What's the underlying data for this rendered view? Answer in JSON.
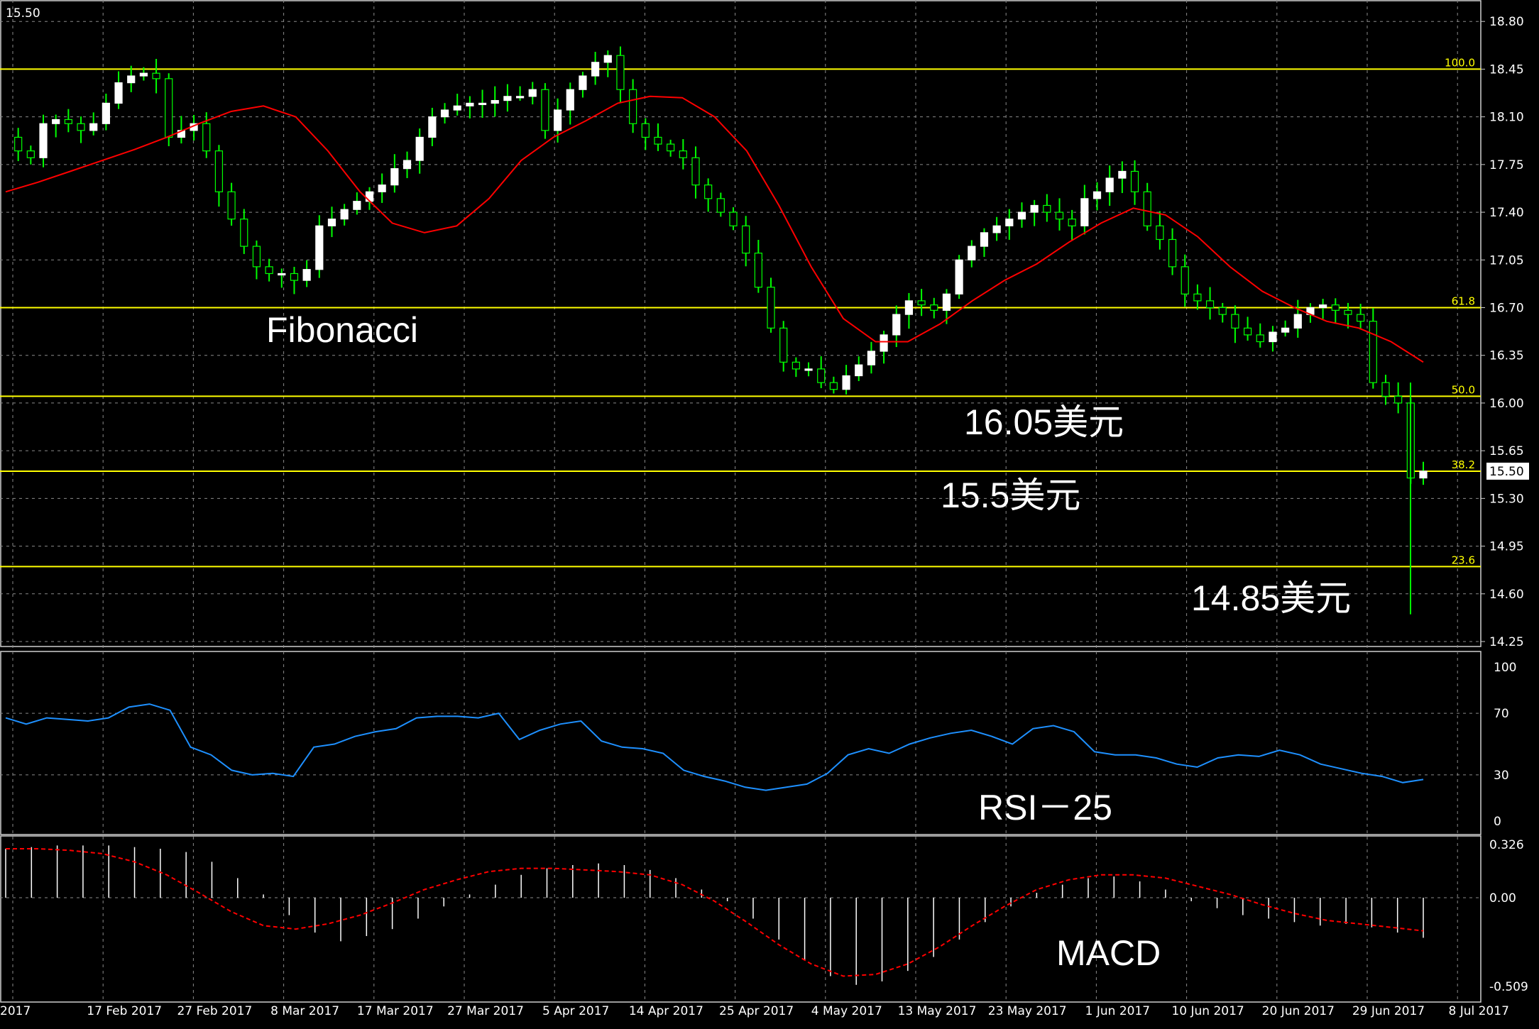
{
  "symbol_label": "15.50",
  "colors": {
    "background": "#000000",
    "grid": "#8a8a8a",
    "bull_candle": "#ffffff",
    "bear_candle": "#000000",
    "wick": "#00ff00",
    "ma_line": "#ff0000",
    "fib_line": "#ffff00",
    "rsi_line": "#1e90ff",
    "macd_histogram": "#ffffff",
    "macd_signal": "#ff0000",
    "text": "#ffffff"
  },
  "annotations": {
    "fibonacci": "Fibonacci",
    "level_1605": "16.05美元",
    "level_155": "15.5美元",
    "level_1485": "14.85美元",
    "rsi": "RSI－25",
    "macd": "MACD"
  },
  "chart_data": [
    {
      "type": "candlestick",
      "panel": "price",
      "ylim": [
        14.25,
        18.9
      ],
      "y_ticks": [
        "18.80",
        "18.45",
        "18.10",
        "17.75",
        "17.40",
        "17.05",
        "16.70",
        "16.35",
        "16.00",
        "15.65",
        "15.30",
        "14.95",
        "14.60",
        "14.25"
      ],
      "current_price": "15.50",
      "fib_levels": [
        {
          "label": "100.0",
          "value": 18.45
        },
        {
          "label": "61.8",
          "value": 16.7
        },
        {
          "label": "50.0",
          "value": 16.05
        },
        {
          "label": "38.2",
          "value": 15.5
        },
        {
          "label": "23.6",
          "value": 14.8
        }
      ],
      "x_labels": [
        "2017",
        "17 Feb 2017",
        "27 Feb 2017",
        "8 Mar 2017",
        "17 Mar 2017",
        "27 Mar 2017",
        "5 Apr 2017",
        "14 Apr 2017",
        "25 Apr 2017",
        "4 May 2017",
        "13 May 2017",
        "23 May 2017",
        "1 Jun 2017",
        "10 Jun 2017",
        "20 Jun 2017",
        "29 Jun 2017",
        "8 Jul 2017"
      ],
      "close_path": [
        17.95,
        17.85,
        17.8,
        18.05,
        18.08,
        18.05,
        18.0,
        18.05,
        18.2,
        18.35,
        18.4,
        18.42,
        18.38,
        17.95,
        18.0,
        18.05,
        17.85,
        17.55,
        17.35,
        17.15,
        17.0,
        16.95,
        16.95,
        16.9,
        16.98,
        17.3,
        17.35,
        17.42,
        17.48,
        17.55,
        17.6,
        17.72,
        17.78,
        17.95,
        18.1,
        18.15,
        18.18,
        18.2,
        18.2,
        18.22,
        18.25,
        18.25,
        18.3,
        18.0,
        18.15,
        18.3,
        18.4,
        18.5,
        18.55,
        18.3,
        18.05,
        17.95,
        17.9,
        17.85,
        17.8,
        17.6,
        17.5,
        17.4,
        17.3,
        17.1,
        16.85,
        16.55,
        16.3,
        16.25,
        16.25,
        16.15,
        16.1,
        16.2,
        16.28,
        16.38,
        16.5,
        16.65,
        16.75,
        16.72,
        16.68,
        16.8,
        17.05,
        17.15,
        17.25,
        17.3,
        17.35,
        17.4,
        17.45,
        17.4,
        17.35,
        17.3,
        17.5,
        17.55,
        17.65,
        17.7,
        17.55,
        17.3,
        17.2,
        17.0,
        16.8,
        16.75,
        16.7,
        16.65,
        16.55,
        16.5,
        16.45,
        16.52,
        16.55,
        16.65,
        16.7,
        16.72,
        16.68,
        16.65,
        16.6,
        16.15,
        16.05,
        16.0,
        15.45,
        15.5
      ],
      "ma_path": [
        17.55,
        17.62,
        17.7,
        17.78,
        17.86,
        17.95,
        18.05,
        18.14,
        18.18,
        18.1,
        17.85,
        17.55,
        17.32,
        17.25,
        17.3,
        17.5,
        17.78,
        17.95,
        18.07,
        18.2,
        18.25,
        18.24,
        18.1,
        17.85,
        17.45,
        17.0,
        16.62,
        16.45,
        16.45,
        16.58,
        16.75,
        16.9,
        17.02,
        17.18,
        17.32,
        17.43,
        17.38,
        17.22,
        17.0,
        16.82,
        16.7,
        16.6,
        16.55,
        16.45,
        16.3
      ]
    },
    {
      "type": "line",
      "panel": "RSI",
      "name": "RSI - 25",
      "ylim": [
        0,
        100
      ],
      "y_ticks": [
        100,
        70,
        30,
        0
      ],
      "values": [
        67,
        63,
        67,
        66,
        65,
        67,
        74,
        76,
        72,
        48,
        43,
        33,
        30,
        31,
        29,
        48,
        50,
        55,
        58,
        60,
        67,
        68,
        68,
        67,
        70,
        53,
        59,
        63,
        65,
        52,
        48,
        47,
        44,
        33,
        29,
        26,
        22,
        20,
        22,
        24,
        31,
        43,
        47,
        44,
        50,
        54,
        57,
        59,
        55,
        50,
        60,
        62,
        58,
        45,
        43,
        43,
        41,
        37,
        35,
        41,
        43,
        42,
        46,
        43,
        37,
        34,
        31,
        29,
        25,
        27
      ]
    },
    {
      "type": "bar",
      "panel": "MACD",
      "name": "MACD",
      "ylim": [
        -0.509,
        0.326
      ],
      "y_ticks": [
        "0.326",
        "0.00",
        "-0.509"
      ],
      "histogram": [
        0.3,
        0.31,
        0.32,
        0.32,
        0.32,
        0.31,
        0.3,
        0.28,
        0.22,
        0.12,
        0.02,
        -0.1,
        -0.2,
        -0.25,
        -0.22,
        -0.18,
        -0.12,
        -0.05,
        0.02,
        0.08,
        0.14,
        0.18,
        0.2,
        0.21,
        0.2,
        0.17,
        0.12,
        0.05,
        -0.02,
        -0.12,
        -0.24,
        -0.36,
        -0.45,
        -0.5,
        -0.48,
        -0.42,
        -0.34,
        -0.24,
        -0.14,
        -0.05,
        0.03,
        0.08,
        0.12,
        0.13,
        0.1,
        0.05,
        -0.02,
        -0.06,
        -0.1,
        -0.12,
        -0.14,
        -0.16,
        -0.15,
        -0.17,
        -0.2,
        -0.23
      ],
      "signal": [
        0.3,
        0.3,
        0.29,
        0.27,
        0.22,
        0.14,
        0.03,
        -0.08,
        -0.16,
        -0.18,
        -0.15,
        -0.1,
        -0.03,
        0.05,
        0.11,
        0.16,
        0.18,
        0.18,
        0.17,
        0.16,
        0.14,
        0.08,
        -0.02,
        -0.14,
        -0.27,
        -0.38,
        -0.45,
        -0.44,
        -0.38,
        -0.28,
        -0.16,
        -0.05,
        0.05,
        0.11,
        0.14,
        0.14,
        0.12,
        0.07,
        0.02,
        -0.04,
        -0.09,
        -0.13,
        -0.15,
        -0.17,
        -0.19
      ]
    }
  ]
}
